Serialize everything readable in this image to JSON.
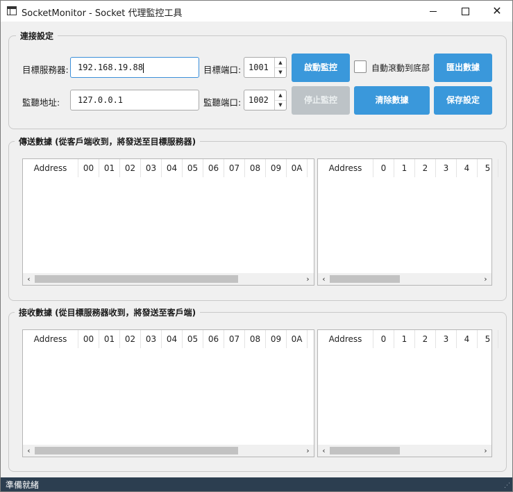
{
  "window": {
    "title": "SocketMonitor - Socket 代理監控工具",
    "controls": {
      "minimize": "minimize",
      "maximize": "maximize",
      "close": "✕"
    }
  },
  "connection": {
    "legend": "連接設定",
    "target_server_label": "目標服務器:",
    "target_server_value": "192.168.19.88",
    "target_port_label": "目標端口:",
    "target_port_value": "1001",
    "listen_addr_label": "監聽地址:",
    "listen_addr_value": "127.0.0.1",
    "listen_port_label": "監聽端口:",
    "listen_port_value": "1002",
    "start_button": "啟動監控",
    "stop_button": "停止監控",
    "auto_scroll_label": "自動滾動到底部",
    "auto_scroll_checked": false,
    "clear_button": "清除數據",
    "export_button": "匯出數據",
    "save_button": "保存設定"
  },
  "sent": {
    "legend": "傳送數據 (從客戶端收到，將發送至目標服務器)",
    "hex_columns": [
      "Address",
      "00",
      "01",
      "02",
      "03",
      "04",
      "05",
      "06",
      "07",
      "08",
      "09",
      "0A"
    ],
    "ascii_columns": [
      "Address",
      "0",
      "1",
      "2",
      "3",
      "4",
      "5"
    ]
  },
  "received": {
    "legend": "接收數據 (從目標服務器收到，將發送至客戶端)",
    "hex_columns": [
      "Address",
      "00",
      "01",
      "02",
      "03",
      "04",
      "05",
      "06",
      "07",
      "08",
      "09",
      "0A"
    ],
    "ascii_columns": [
      "Address",
      "0",
      "1",
      "2",
      "3",
      "4",
      "5"
    ]
  },
  "status": {
    "text": "準備就緒"
  },
  "colors": {
    "accent": "#3a98db",
    "disabled_button": "#bdc3c7",
    "status_bar": "#2c3e50",
    "focus_border": "#3b8fd9"
  },
  "icons": {
    "app": "window-app-icon",
    "scroll_left": "‹",
    "scroll_right": "›",
    "spin_up": "▲",
    "spin_down": "▼",
    "grip": "resize-grip-icon"
  }
}
